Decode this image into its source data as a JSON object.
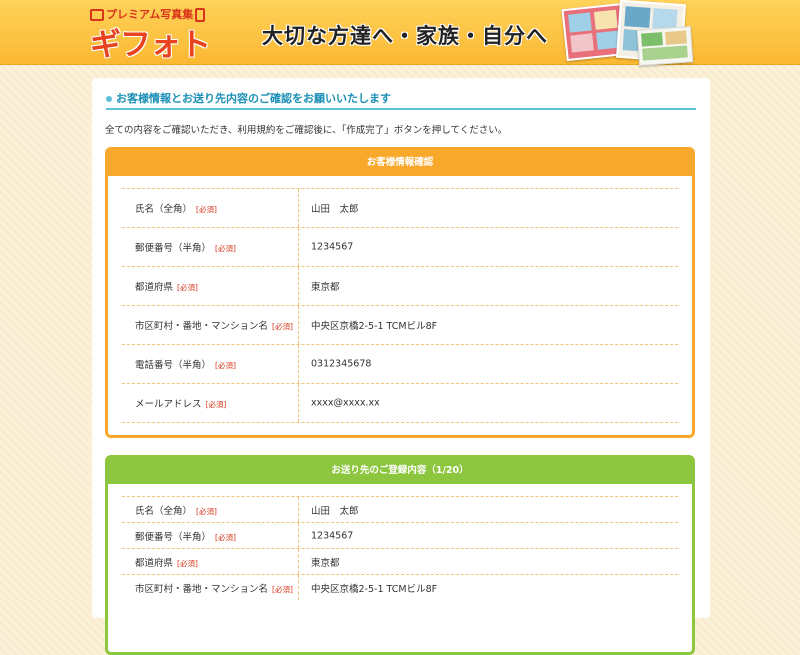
{
  "header": {
    "logo_top": "プレミアム写真集",
    "logo_main": "ギフォト",
    "tagline": "大切な方達へ・家族・自分へ"
  },
  "main": {
    "title": "お客様情報とお送り先内容のご確認をお願いいたします",
    "intro": "全ての内容をご確認いただき、利用規約をご確認後に、「作成完了」ボタンを押してください。",
    "required_label": "[必須]",
    "customer": {
      "heading": "お客様情報確認",
      "rows": [
        {
          "label": "氏名（全角）",
          "value": "山田　太郎"
        },
        {
          "label": "郵便番号（半角）",
          "value": "1234567"
        },
        {
          "label": "都道府県",
          "value": "東京都"
        },
        {
          "label": "市区町村・番地・マンション名",
          "value": "中央区京橋2-5-1 TCMビル8F"
        },
        {
          "label": "電話番号（半角）",
          "value": "0312345678"
        },
        {
          "label": "メールアドレス",
          "value": "xxxx@xxxx.xx"
        }
      ]
    },
    "recipient": {
      "heading": "お送り先のご登録内容（1/20）",
      "rows": [
        {
          "label": "氏名（全角）",
          "value": "山田　太郎"
        },
        {
          "label": "郵便番号（半角）",
          "value": "1234567"
        },
        {
          "label": "都道府県",
          "value": "東京都"
        },
        {
          "label": "市区町村・番地・マンション名",
          "value": "中央区京橋2-5-1 TCMビル8F"
        }
      ]
    }
  },
  "colors": {
    "header_bg": "#fbb832",
    "accent_orange": "#f8a92b",
    "accent_green": "#8cc63f",
    "title_blue": "#1a8fb5",
    "required_red": "#d8341a"
  },
  "icons": [
    "camera-icon",
    "phone-icon"
  ]
}
